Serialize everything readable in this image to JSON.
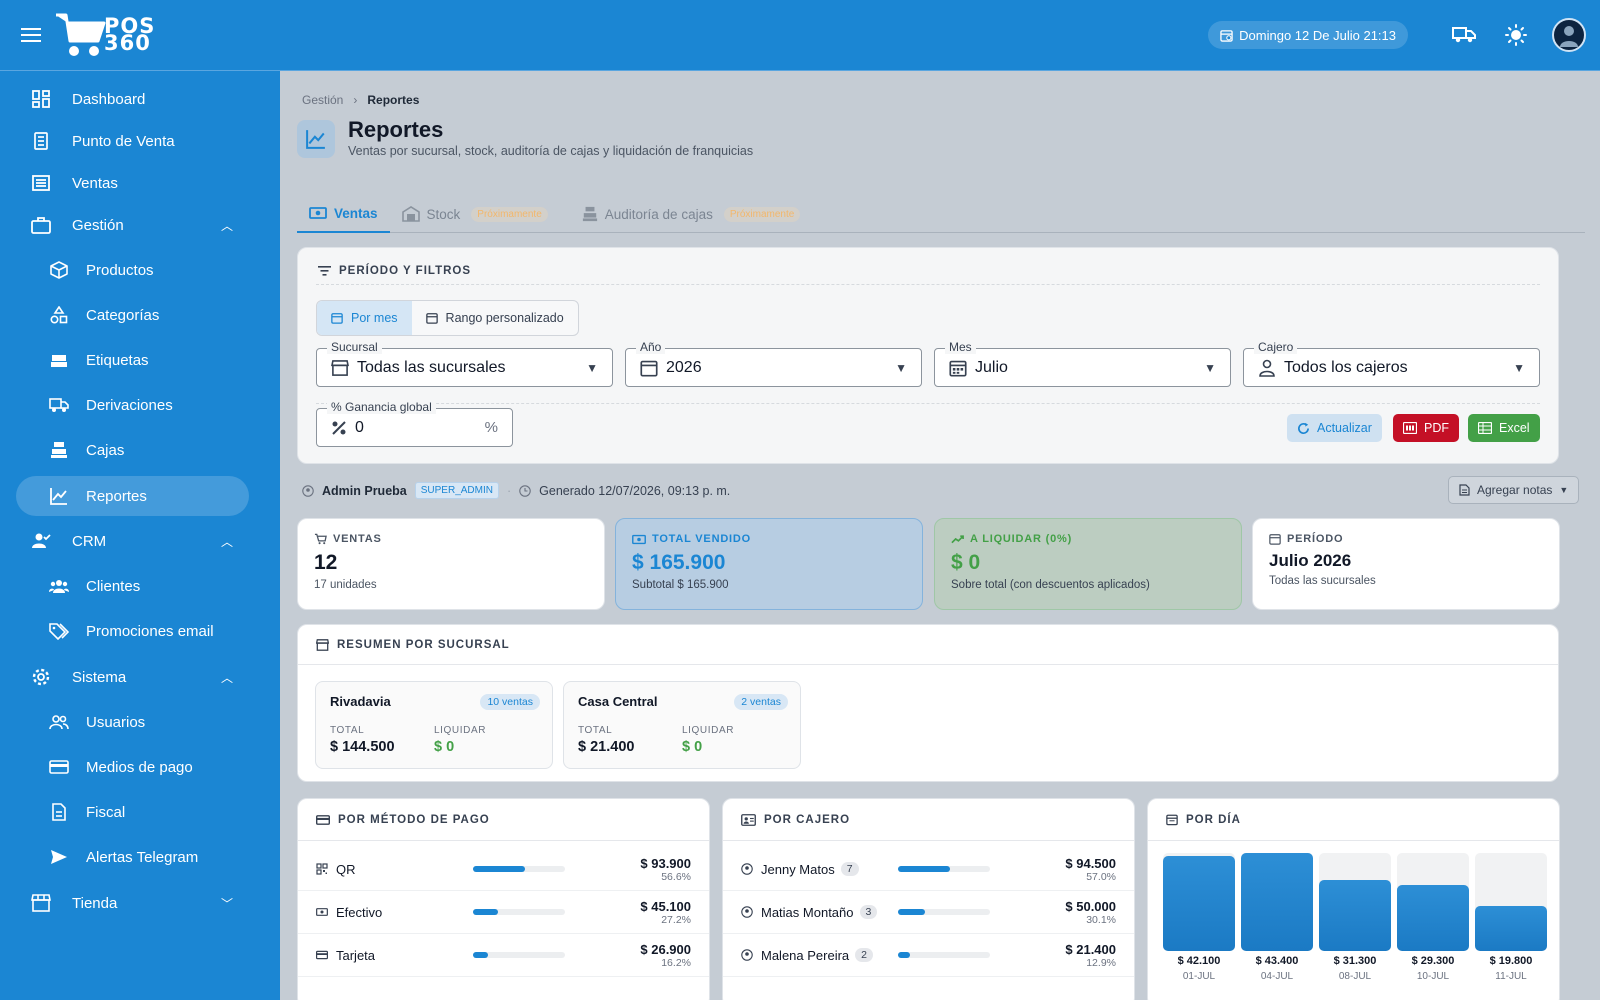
{
  "app": {
    "logo_text_1": "POS",
    "logo_text_2": "360"
  },
  "topbar": {
    "date": "Domingo 12 De Julio 21:13"
  },
  "sidebar": {
    "items": [
      {
        "label": "Dashboard",
        "icon": "dashboard-icon"
      },
      {
        "label": "Punto de Venta",
        "icon": "pos-register-icon"
      },
      {
        "label": "Ventas",
        "icon": "receipt-icon"
      },
      {
        "label": "Gestión",
        "icon": "briefcase-icon"
      },
      {
        "label": "Productos",
        "icon": "cube-icon"
      },
      {
        "label": "Categorías",
        "icon": "category-icon"
      },
      {
        "label": "Etiquetas",
        "icon": "label-printer-icon"
      },
      {
        "label": "Derivaciones",
        "icon": "truck-icon"
      },
      {
        "label": "Cajas",
        "icon": "cash-register-icon"
      },
      {
        "label": "Reportes",
        "icon": "chart-line-icon"
      },
      {
        "label": "CRM",
        "icon": "crm-icon"
      },
      {
        "label": "Clientes",
        "icon": "group-icon"
      },
      {
        "label": "Promociones email",
        "icon": "tags-icon"
      },
      {
        "label": "Sistema",
        "icon": "gear-icon"
      },
      {
        "label": "Usuarios",
        "icon": "users-icon"
      },
      {
        "label": "Medios de pago",
        "icon": "credit-card-icon"
      },
      {
        "label": "Fiscal",
        "icon": "document-icon"
      },
      {
        "label": "Alertas Telegram",
        "icon": "send-icon"
      },
      {
        "label": "Tienda",
        "icon": "store-icon"
      }
    ]
  },
  "breadcrumb": {
    "parent": "Gestión",
    "current": "Reportes"
  },
  "page": {
    "title": "Reportes",
    "subtitle": "Ventas por sucursal, stock, auditoría de cajas y liquidación de franquicias"
  },
  "tabs": [
    {
      "label": "Ventas"
    },
    {
      "label": "Stock",
      "badge": "Próximamente"
    },
    {
      "label": "Auditoría de cajas",
      "badge": "Próximamente"
    }
  ],
  "filters": {
    "title": "PERÍODO Y FILTROS",
    "mode_month": "Por mes",
    "mode_range": "Rango personalizado",
    "branch_label": "Sucursal",
    "branch_value": "Todas las sucursales",
    "year_label": "Año",
    "year_value": "2026",
    "month_label": "Mes",
    "month_value": "Julio",
    "cashier_label": "Cajero",
    "cashier_value": "Todos los cajeros",
    "margin_label": "% Ganancia global",
    "margin_value": "0",
    "margin_suffix": "%",
    "refresh": "Actualizar",
    "pdf": "PDF",
    "excel": "Excel"
  },
  "meta": {
    "user": "Admin Prueba",
    "role": "SUPER_ADMIN",
    "generated": "Generado 12/07/2026, 09:13 p. m.",
    "notes": "Agregar notas"
  },
  "kpis": [
    {
      "label": "VENTAS",
      "value": "12",
      "sub": "17 unidades"
    },
    {
      "label": "TOTAL VENDIDO",
      "value": "$ 165.900",
      "sub": "Subtotal $ 165.900"
    },
    {
      "label": "A LIQUIDAR (0%)",
      "value": "$ 0",
      "sub": "Sobre total (con descuentos aplicados)"
    },
    {
      "label": "PERÍODO",
      "value": "Julio 2026",
      "sub": "Todas las sucursales"
    }
  ],
  "branches": {
    "title": "RESUMEN POR SUCURSAL",
    "total_label": "TOTAL",
    "liquidar_label": "LIQUIDAR",
    "items": [
      {
        "name": "Rivadavia",
        "badge": "10 ventas",
        "total": "$ 144.500",
        "liquidar": "$ 0"
      },
      {
        "name": "Casa Central",
        "badge": "2 ventas",
        "total": "$ 21.400",
        "liquidar": "$ 0"
      }
    ]
  },
  "payment": {
    "title": "POR MÉTODO DE PAGO",
    "rows": [
      {
        "name": "QR",
        "amount": "$ 93.900",
        "pct": "56.6%",
        "share": 0.566
      },
      {
        "name": "Efectivo",
        "amount": "$ 45.100",
        "pct": "27.2%",
        "share": 0.272
      },
      {
        "name": "Tarjeta",
        "amount": "$ 26.900",
        "pct": "16.2%",
        "share": 0.162
      }
    ]
  },
  "cashier": {
    "title": "POR CAJERO",
    "rows": [
      {
        "name": "Jenny Matos",
        "count": "7",
        "amount": "$ 94.500",
        "pct": "57.0%",
        "share": 0.57
      },
      {
        "name": "Matias Montaño",
        "count": "3",
        "amount": "$ 50.000",
        "pct": "30.1%",
        "share": 0.301
      },
      {
        "name": "Malena Pereira",
        "count": "2",
        "amount": "$ 21.400",
        "pct": "12.9%",
        "share": 0.129
      }
    ]
  },
  "daily": {
    "title": "POR DÍA",
    "days": [
      {
        "date": "01-JUL",
        "amount": "$ 42.100",
        "value": 42100
      },
      {
        "date": "04-JUL",
        "amount": "$ 43.400",
        "value": 43400
      },
      {
        "date": "08-JUL",
        "amount": "$ 31.300",
        "value": 31300
      },
      {
        "date": "10-JUL",
        "amount": "$ 29.300",
        "value": 29300
      },
      {
        "date": "11-JUL",
        "amount": "$ 19.800",
        "value": 19800
      }
    ]
  },
  "colors": {
    "primary": "#1b86d3",
    "success": "#43a047",
    "danger": "#c41026",
    "background": "#c5ccd4"
  }
}
